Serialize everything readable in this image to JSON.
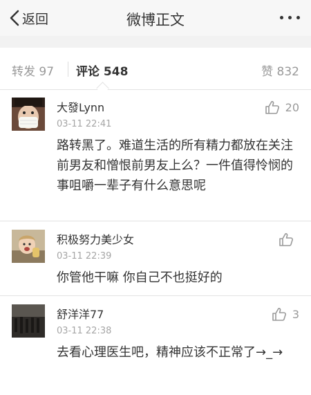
{
  "nav": {
    "back_label": "返回",
    "title": "微博正文"
  },
  "tabs": {
    "repost_label": "转发",
    "repost_count": "97",
    "comment_label": "评论",
    "comment_count": "548",
    "like_label": "赞",
    "like_count": "832"
  },
  "comments": [
    {
      "username": "大發Lynn",
      "time": "03-11 22:41",
      "text": "路转黑了。难道生活的所有精力都放在关注前男友和憎恨前男友上么？一件值得怜悯的事咀嚼一辈子有什么意思呢",
      "likes": "20",
      "avatar_icon": "masked-person-avatar"
    },
    {
      "username": "积极努力美少女",
      "time": "03-11 22:39",
      "text": "你管他干嘛 你自己不也挺好的",
      "likes": "",
      "avatar_icon": "child-photo-avatar"
    },
    {
      "username": "舒洋洋77",
      "time": "03-11 22:38",
      "text": "去看心理医生吧，精神应该不正常了→_→",
      "likes": "3",
      "avatar_icon": "dark-crowd-avatar"
    }
  ],
  "colors": {
    "muted": "#999999",
    "time": "#a5a5a5",
    "text": "#333333",
    "divider": "#e2e2e2"
  }
}
